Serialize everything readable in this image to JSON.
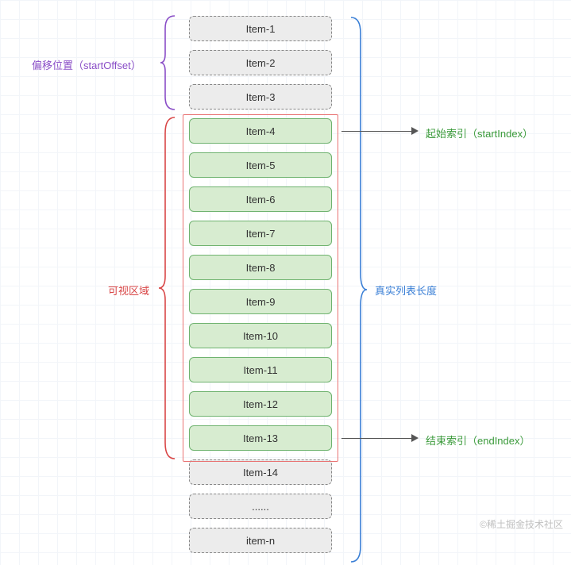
{
  "items": {
    "offset": [
      "Item-1",
      "Item-2",
      "Item-3"
    ],
    "visible": [
      "Item-4",
      "Item-5",
      "Item-6",
      "Item-7",
      "Item-8",
      "Item-9",
      "Item-10",
      "Item-11",
      "Item-12",
      "Item-13"
    ],
    "tail": [
      "Item-14",
      "......",
      "item-n"
    ]
  },
  "labels": {
    "offset": "偏移位置（startOffset）",
    "viewport": "可视区域",
    "full": "真实列表长度",
    "start": "起始索引（startIndex）",
    "end": "结束索引（endIndex）"
  },
  "watermark": "©稀土掘金技术社区"
}
